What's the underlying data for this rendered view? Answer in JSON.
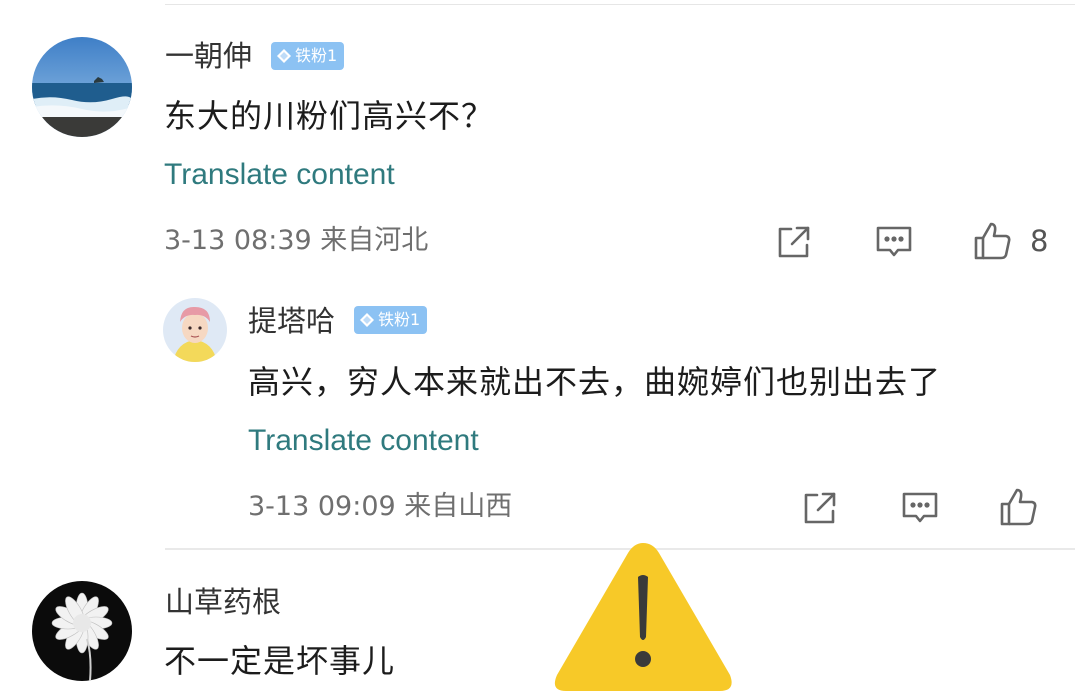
{
  "comments": [
    {
      "username": "一朝伸",
      "badge": "铁粉1",
      "text": "东大的川粉们高兴不？",
      "translate": "Translate content",
      "meta": "3-13 08:39 来自河北",
      "likes": "8"
    },
    {
      "username": "提塔哈",
      "badge": "铁粉1",
      "text": "高兴，穷人本来就出不去，曲婉婷们也别出去了",
      "translate": "Translate content",
      "meta": "3-13 09:09 来自山西",
      "likes": ""
    },
    {
      "username": "山草药根",
      "text": "不一定是坏事儿"
    }
  ],
  "icons": {
    "share": "share-icon",
    "reply": "comment-icon",
    "like": "thumbs-up-icon",
    "badge": "diamond-icon",
    "overlay": "warning-icon"
  },
  "colors": {
    "translate": "#2f7a7e",
    "badge": "#8cc2f3",
    "warning": "#f7c928"
  }
}
